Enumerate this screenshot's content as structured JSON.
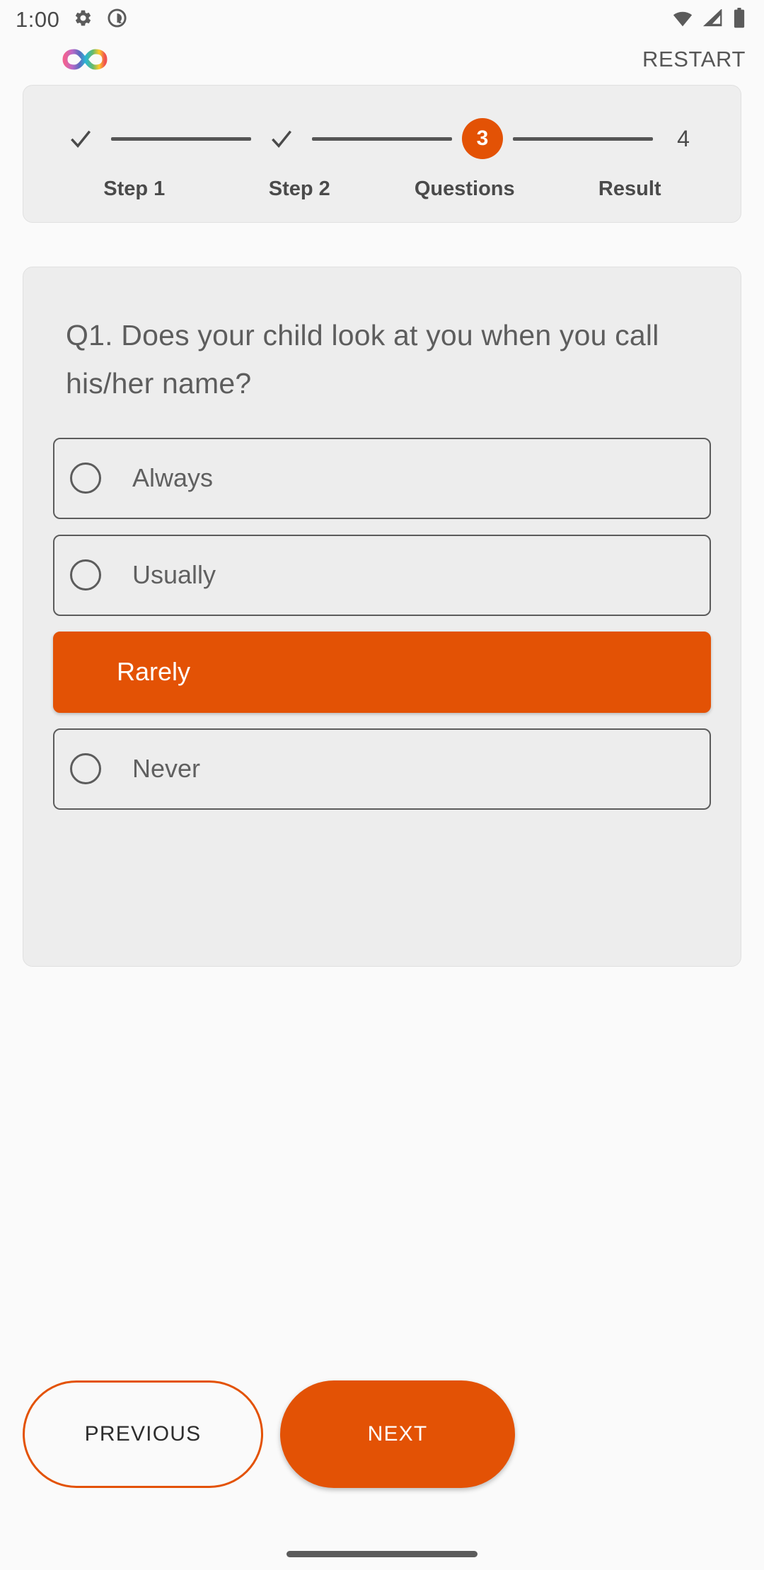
{
  "statusbar": {
    "time": "1:00",
    "icons_left": [
      "gear-icon",
      "android-q-icon"
    ],
    "icons_right": [
      "wifi-icon",
      "signal-icon",
      "battery-icon"
    ]
  },
  "appbar": {
    "logo": "infinity-rainbow-logo",
    "restart_label": "RESTART"
  },
  "stepper": {
    "current_step": 3,
    "total_steps": 4,
    "steps": [
      {
        "indicator": "✓",
        "label": "Step 1",
        "state": "done"
      },
      {
        "indicator": "✓",
        "label": "Step 2",
        "state": "done"
      },
      {
        "indicator": "3",
        "label": "Questions",
        "state": "active"
      },
      {
        "indicator": "4",
        "label": "Result",
        "state": "pending"
      }
    ],
    "accent_color": "#e35205"
  },
  "question": {
    "text": "Q1. Does your child look at you when you call his/her name?",
    "options": [
      {
        "label": "Always",
        "selected": false
      },
      {
        "label": "Usually",
        "selected": false
      },
      {
        "label": "Rarely",
        "selected": true
      },
      {
        "label": "Never",
        "selected": false
      }
    ]
  },
  "footer": {
    "previous_label": "PREVIOUS",
    "next_label": "NEXT"
  },
  "colors": {
    "accent": "#e35205",
    "card_bg": "#ededed",
    "page_bg": "#fafafa",
    "text": "#5d5d5d"
  }
}
